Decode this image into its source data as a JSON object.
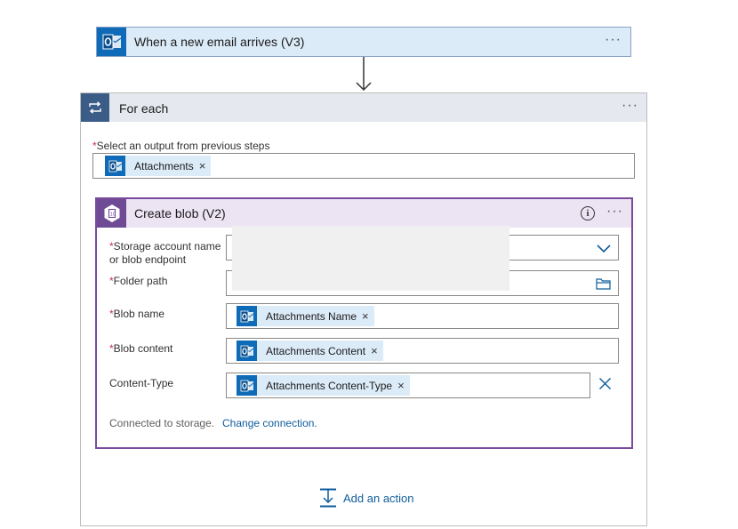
{
  "trigger": {
    "title": "When a new email arrives (V3)",
    "icon": "outlook-icon",
    "menu_glyph": "···"
  },
  "foreach": {
    "title": "For each",
    "icon": "loop-icon",
    "menu_glyph": "···",
    "select_label": "Select an output from previous steps",
    "required_mark": "*",
    "token": {
      "text": "Attachments",
      "remove": "×"
    }
  },
  "blob": {
    "title": "Create blob (V2)",
    "icon": "storage-blob-icon",
    "info_glyph": "i",
    "menu_glyph": "···",
    "accent_color": "#7a4a9d",
    "fields": {
      "storage_account": {
        "label_line1": "Storage account name",
        "label_line2": "or blob endpoint",
        "required": "*"
      },
      "folder_path": {
        "label": "Folder path",
        "required": "*"
      },
      "blob_name": {
        "label": "Blob name",
        "required": "*",
        "token": "Attachments Name",
        "remove": "×"
      },
      "blob_content": {
        "label": "Blob content",
        "required": "*",
        "token": "Attachments Content",
        "remove": "×"
      },
      "content_type": {
        "label": "Content-Type",
        "token": "Attachments Content-Type",
        "remove": "×"
      }
    },
    "connection_text": "Connected to storage.",
    "change_connection": "Change connection."
  },
  "add_action": {
    "label": "Add an action"
  },
  "colors": {
    "outlook_blue": "#0f6ab7",
    "trigger_bg": "#dcebf8",
    "loop_blue": "#3b5c87",
    "link": "#0f5d9c",
    "required": "#c4314b"
  }
}
